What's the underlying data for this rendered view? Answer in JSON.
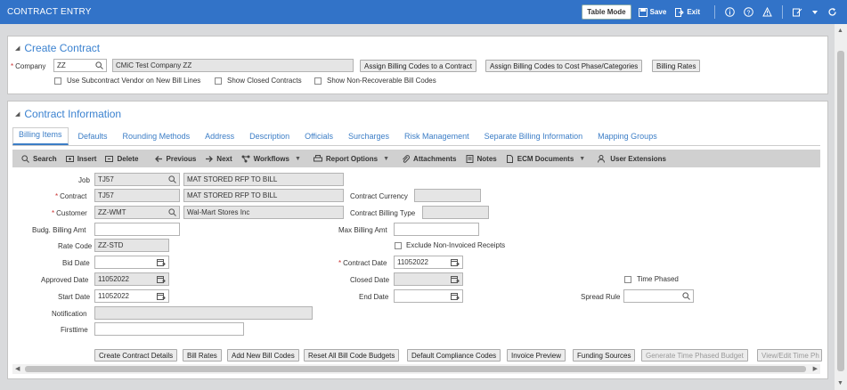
{
  "window": {
    "title": "CONTRACT ENTRY",
    "table_mode_label": "Table Mode",
    "save_label": "Save",
    "exit_label": "Exit"
  },
  "create_contract": {
    "title": "Create Contract",
    "company_label": "Company",
    "company_value": "ZZ",
    "company_name": "CMiC Test Company ZZ",
    "buttons": {
      "assign_billing": "Assign Billing Codes to a Contract",
      "assign_cost_phase": "Assign Billing Codes to Cost Phase/Categories",
      "billing_rates": "Billing Rates"
    },
    "checkboxes": {
      "use_subcontract": "Use Subcontract Vendor on New Bill Lines",
      "show_closed": "Show Closed Contracts",
      "show_nonrecoverable": "Show Non-Recoverable Bill Codes"
    }
  },
  "contract_info": {
    "title": "Contract Information",
    "tabs": [
      {
        "label": "Billing Items"
      },
      {
        "label": "Defaults"
      },
      {
        "label": "Rounding Methods"
      },
      {
        "label": "Address"
      },
      {
        "label": "Description"
      },
      {
        "label": "Officials"
      },
      {
        "label": "Surcharges"
      },
      {
        "label": "Risk Management"
      },
      {
        "label": "Separate Billing Information"
      },
      {
        "label": "Mapping Groups"
      }
    ],
    "toolbar": {
      "search": "Search",
      "insert": "Insert",
      "delete": "Delete",
      "previous": "Previous",
      "next": "Next",
      "workflows": "Workflows",
      "report_options": "Report Options",
      "attachments": "Attachments",
      "notes": "Notes",
      "ecm_documents": "ECM Documents",
      "user_extensions": "User Extensions"
    },
    "fields": {
      "job_label": "Job",
      "job_value": "TJ57",
      "job_name": "MAT STORED RFP TO BILL",
      "contract_label": "Contract",
      "contract_value": "TJ57",
      "contract_name": "MAT STORED RFP TO BILL",
      "contract_currency_label": "Contract Currency",
      "customer_label": "Customer",
      "customer_value": "ZZ-WMT",
      "customer_name": "Wal-Mart Stores Inc",
      "contract_billing_type_label": "Contract Billing Type",
      "budg_billing_amt_label": "Budg. Billing Amt",
      "max_billing_amt_label": "Max Billing Amt",
      "rate_code_label": "Rate Code",
      "rate_code_value": "ZZ-STD",
      "exclude_label": "Exclude Non-Invoiced Receipts",
      "bid_date_label": "Bid Date",
      "contract_date_label": "Contract Date",
      "contract_date_value": "11052022",
      "approved_date_label": "Approved Date",
      "approved_date_value": "11052022",
      "closed_date_label": "Closed Date",
      "time_phased_label": "Time Phased",
      "start_date_label": "Start Date",
      "start_date_value": "11052022",
      "end_date_label": "End Date",
      "spread_rule_label": "Spread Rule",
      "notification_label": "Notification",
      "firsttime_label": "Firsttime"
    },
    "bottom_buttons": {
      "create_details": "Create Contract Details",
      "bill_rates": "Bill Rates",
      "add_new_bill_codes": "Add New Bill Codes",
      "reset_all_budgets": "Reset All Bill Code Budgets",
      "default_compliance": "Default Compliance Codes",
      "invoice_preview": "Invoice Preview",
      "funding_sources": "Funding Sources",
      "generate_time_phased": "Generate Time Phased Budget",
      "view_edit_time": "View/Edit Time Ph"
    }
  }
}
